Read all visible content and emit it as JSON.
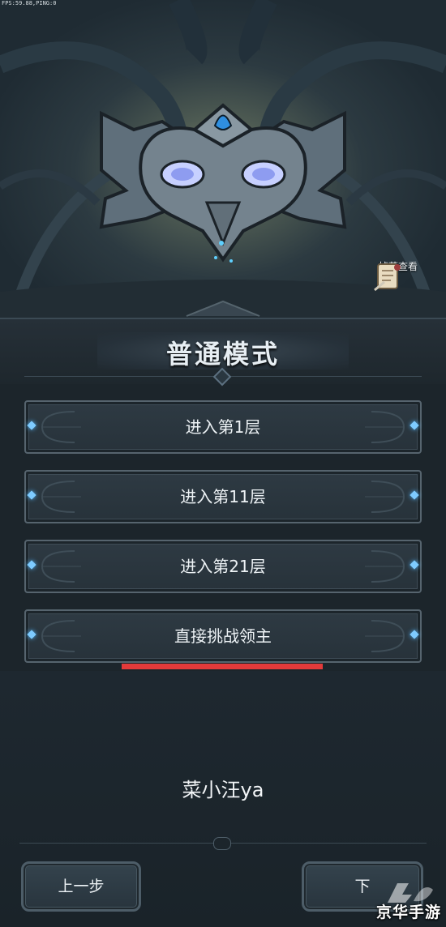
{
  "hud": {
    "fps_text": "FPS:59.88,PING:0"
  },
  "loot": {
    "label": "掉落查看",
    "icon": "scroll-icon"
  },
  "mode": {
    "title": "普通模式"
  },
  "floors": [
    {
      "label": "进入第1层"
    },
    {
      "label": "进入第11层"
    },
    {
      "label": "进入第21层"
    },
    {
      "label": "直接挑战领主"
    }
  ],
  "player": {
    "name": "菜小汪ya"
  },
  "nav": {
    "prev_label": "上一步",
    "next_label": "下"
  },
  "watermark": {
    "text": "京华手游"
  },
  "colors": {
    "accent_gem": "#7ecbff",
    "highlight_underline": "#e43a3a",
    "background": "#1c252b"
  }
}
